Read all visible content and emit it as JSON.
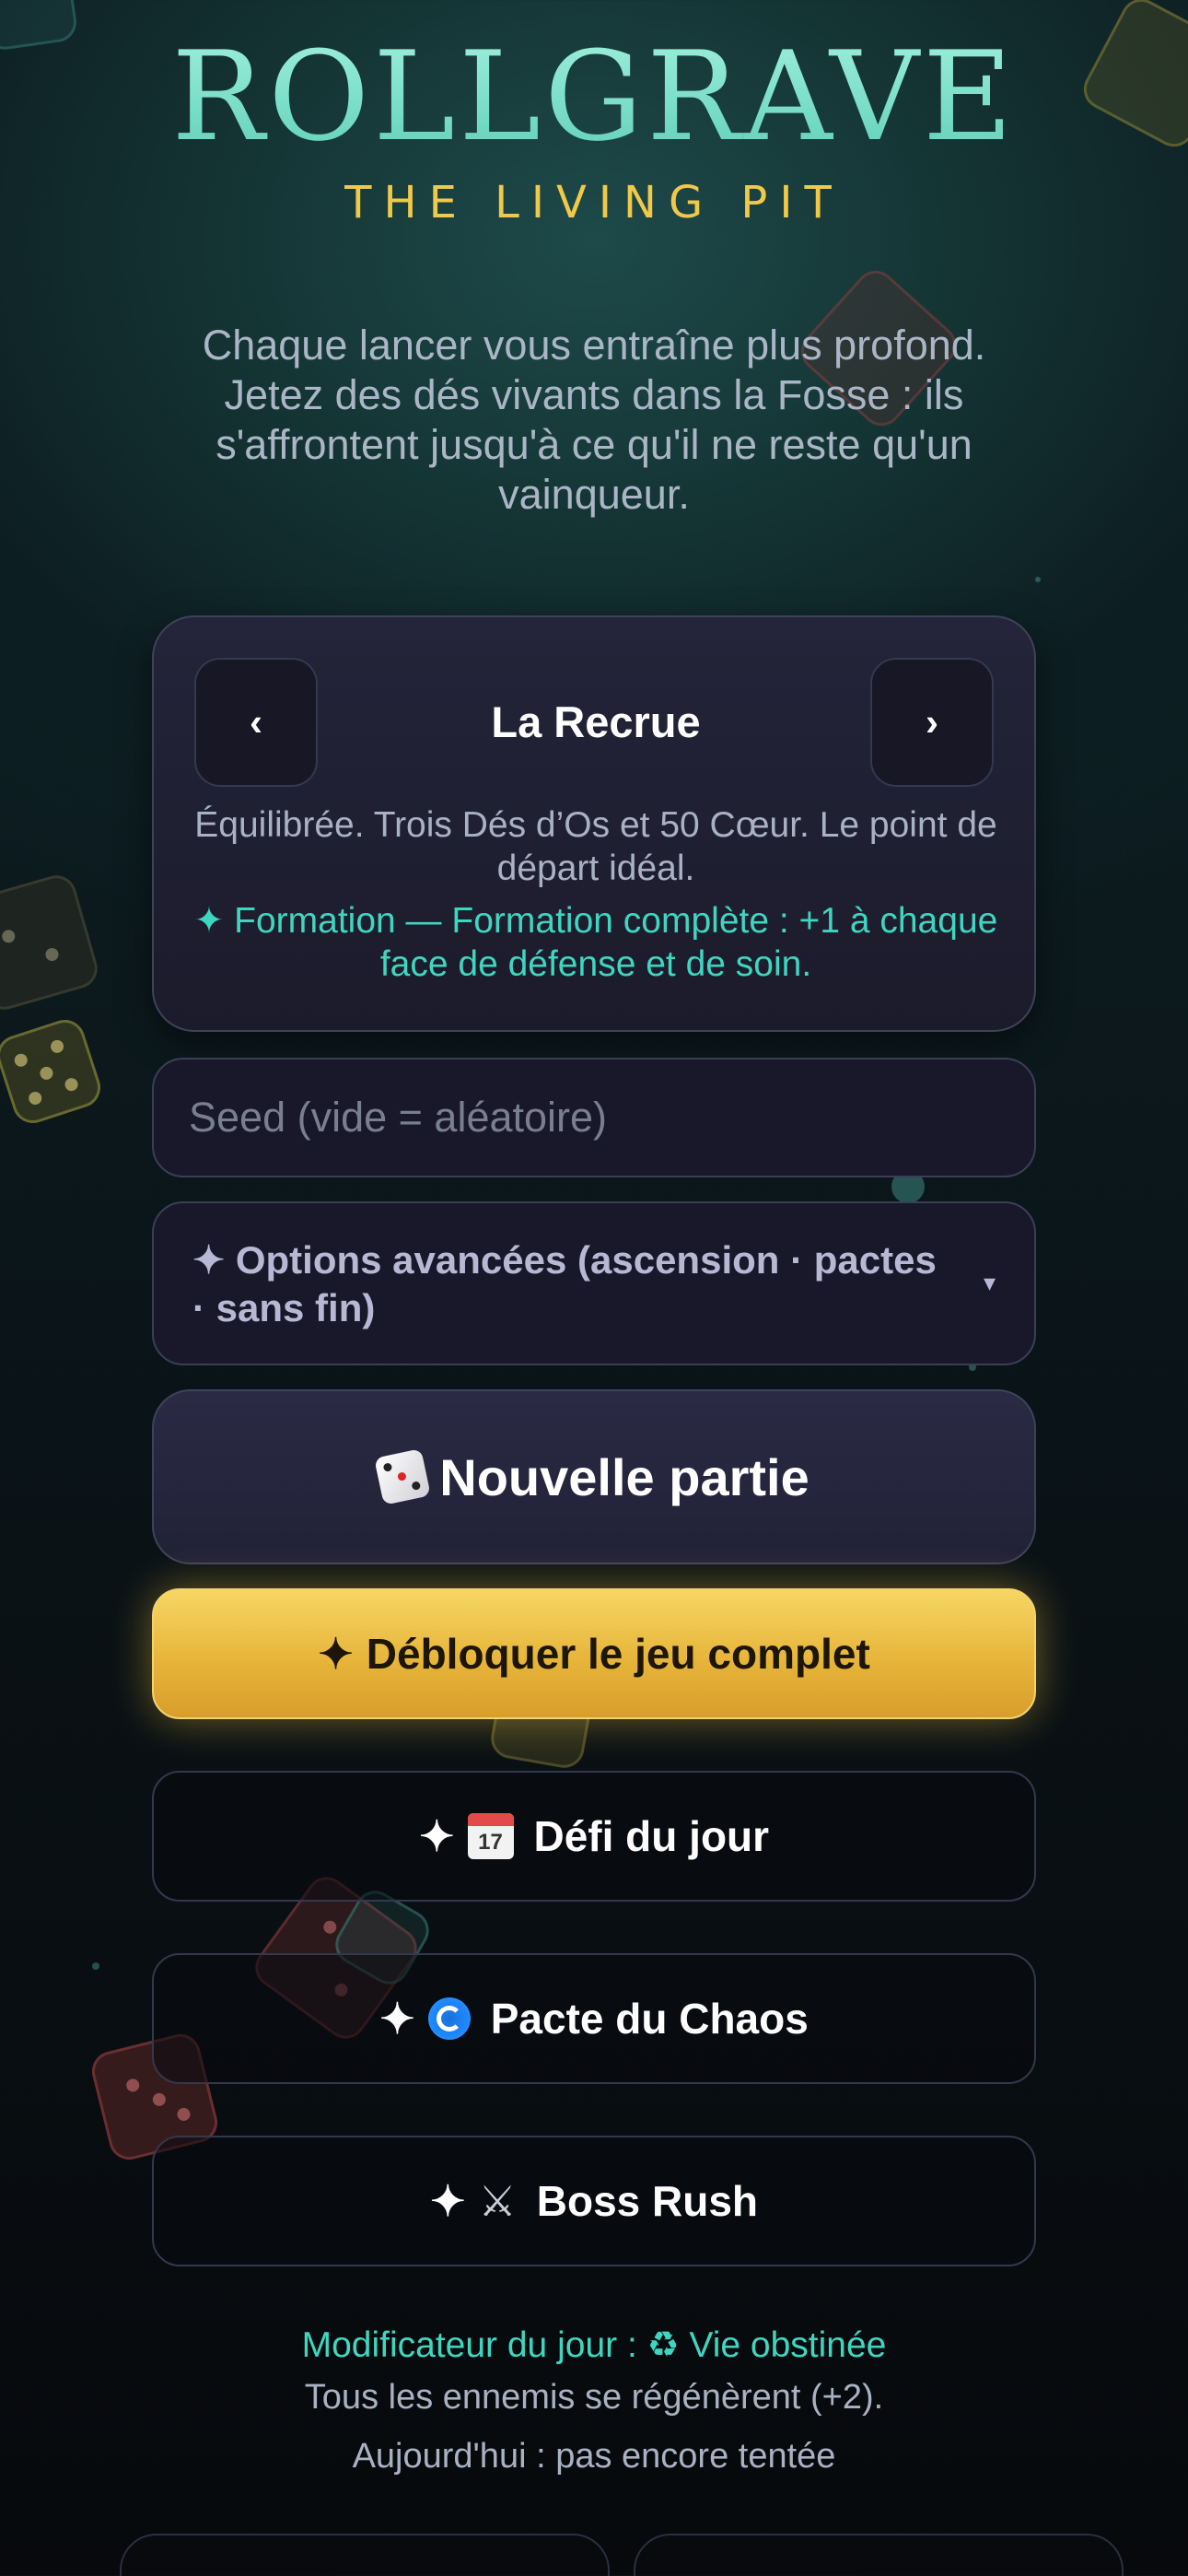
{
  "header": {
    "title": "ROLLGRAVE",
    "subtitle": "THE LIVING PIT"
  },
  "intro": "Chaque lancer vous entraîne plus profond. Jetez des dés vivants dans la Fosse : ils s'affrontent jusqu'à ce qu'il ne reste qu'un vainqueur.",
  "difficulty": {
    "prev_label": "‹",
    "next_label": "›",
    "name": "La Recrue",
    "description": "Équilibrée. Trois Dés d’Os et 50 Cœur. Le point de départ idéal.",
    "perk": "✦ Formation — Formation complète : +1 à chaque face de défense et de soin."
  },
  "seed": {
    "placeholder": "Seed (vide = aléatoire)",
    "value": ""
  },
  "advanced": {
    "label": "✦ Options avancées (ascension · pactes · sans fin)",
    "caret": "▾"
  },
  "buttons": {
    "new_game": "Nouvelle partie",
    "new_game_icon": "game-die-icon",
    "unlock_star": "✦",
    "unlock": "Débloquer le jeu complet",
    "daily_star": "✦",
    "daily_icon": "calendar-icon",
    "daily_icon_day": "17",
    "daily": "Défi du jour",
    "chaos_star": "✦",
    "chaos_icon": "cyclone-icon",
    "chaos": "Pacte du Chaos",
    "boss_star": "✦",
    "boss_icon": "crossed-swords-icon",
    "boss_glyph": "⚔",
    "boss": "Boss Rush"
  },
  "daily_modifier": {
    "line": "Modificateur du jour : ♻ Vie obstinée",
    "description": "Tous les ennemis se régénèrent (+2).",
    "status": "Aujourd'hui : pas encore tentée"
  },
  "colors": {
    "accent_teal": "#3fd6c0",
    "title_teal": "#9ff0dc",
    "gold": "#f0c94a",
    "unlock_button": "#e7b53a",
    "background": "#0c1a1e"
  }
}
